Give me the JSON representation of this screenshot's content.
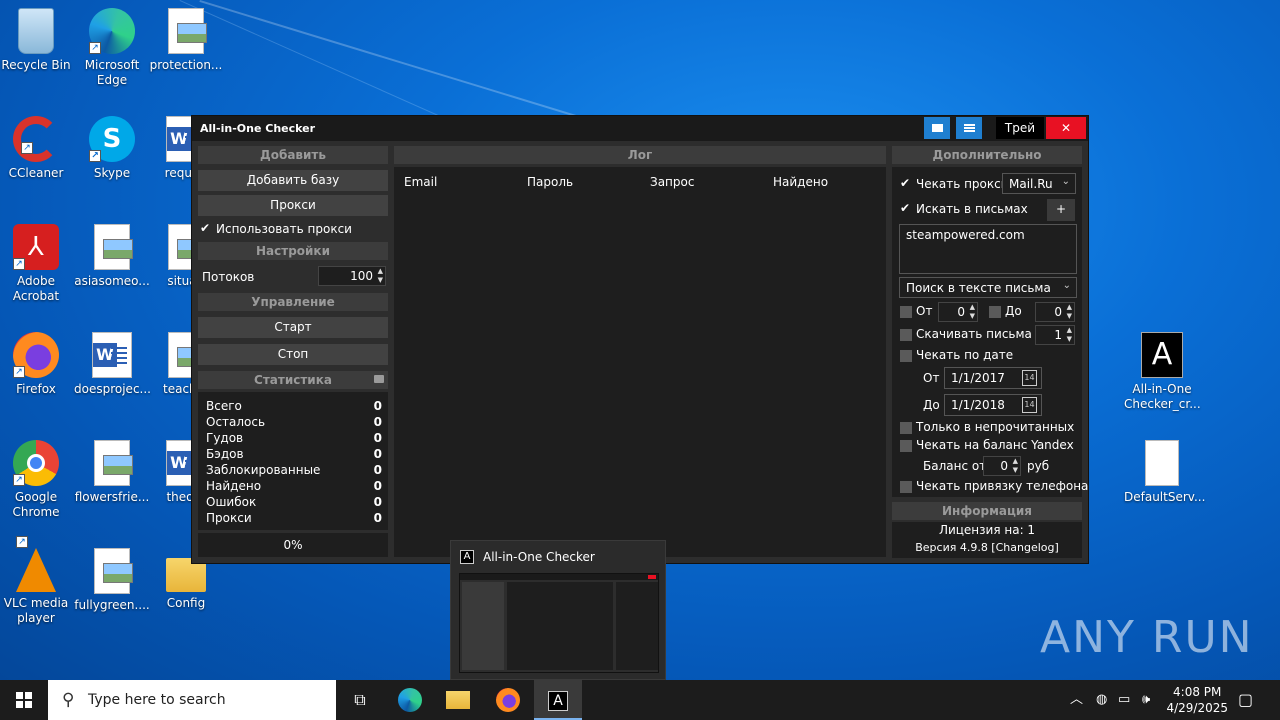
{
  "desktop": {
    "icons": [
      {
        "id": "recycle",
        "label": "Recycle Bin"
      },
      {
        "id": "edge",
        "label": "Microsoft Edge"
      },
      {
        "id": "protection",
        "label": "protection..."
      },
      {
        "id": "ccleaner",
        "label": "CCleaner"
      },
      {
        "id": "skype",
        "label": "Skype"
      },
      {
        "id": "require",
        "label": "require"
      },
      {
        "id": "acrobat",
        "label": "Adobe Acrobat"
      },
      {
        "id": "asiasomeo",
        "label": "asiasomeo..."
      },
      {
        "id": "situati",
        "label": "situati"
      },
      {
        "id": "firefox",
        "label": "Firefox"
      },
      {
        "id": "doesprojec",
        "label": "doesprojec..."
      },
      {
        "id": "teacher",
        "label": "teacher"
      },
      {
        "id": "chrome",
        "label": "Google Chrome"
      },
      {
        "id": "flowersfrie",
        "label": "flowersfrie..."
      },
      {
        "id": "theory",
        "label": "theory"
      },
      {
        "id": "vlc",
        "label": "VLC media player"
      },
      {
        "id": "fullygreen",
        "label": "fullygreen...."
      },
      {
        "id": "config",
        "label": "Config"
      },
      {
        "id": "aio",
        "label": "All-in-One Checker_cr..."
      },
      {
        "id": "defaultserv",
        "label": "DefaultServ..."
      }
    ],
    "watermark": "ANY RUN"
  },
  "window": {
    "title": "All-in-One Checker",
    "tray_label": "Трей",
    "close_glyph": "✕",
    "left": {
      "add_header": "Добавить",
      "add_base": "Добавить базу",
      "proxy": "Прокси",
      "use_proxy": "Использовать прокси",
      "settings_header": "Настройки",
      "threads_label": "Потоков",
      "threads_value": "100",
      "control_header": "Управление",
      "start": "Старт",
      "stop": "Стоп",
      "stats_header": "Статистика",
      "stats": [
        {
          "label": "Всего",
          "value": "0"
        },
        {
          "label": "Осталось",
          "value": "0"
        },
        {
          "label": "Гудов",
          "value": "0"
        },
        {
          "label": "Бэдов",
          "value": "0"
        },
        {
          "label": "Заблокированные",
          "value": "0"
        },
        {
          "label": "Найдено",
          "value": "0"
        },
        {
          "label": "Ошибок",
          "value": "0"
        },
        {
          "label": "Прокси",
          "value": "0"
        }
      ],
      "progress": "0%"
    },
    "log": {
      "header": "Лог",
      "columns": [
        "Email",
        "Пароль",
        "Запрос",
        "Найдено"
      ]
    },
    "right": {
      "header": "Дополнительно",
      "check_proxy": "Чекать прокси",
      "provider": "Mail.Ru",
      "search_in_letters": "Искать в письмах",
      "plus": "+",
      "search_text": "steampowered.com",
      "search_mode": "Поиск в тексте письма",
      "from_label": "От",
      "from_value": "0",
      "to_label": "До",
      "to_value": "0",
      "download_letters": "Скачивать письма",
      "download_value": "1",
      "check_by_date": "Чекать по дате",
      "date_from_label": "От",
      "date_from": "1/1/2017",
      "date_to_label": "До",
      "date_to": "1/1/2018",
      "unread_only": "Только в непрочитанных",
      "yandex_balance": "Чекать на баланс Yandex",
      "balance_from": "Баланс от",
      "balance_value": "0",
      "currency": "руб",
      "phone_binding": "Чекать привязку телефона",
      "info_header": "Информация",
      "license": "Лицензия на: 1",
      "version": "Версия 4.9.8 [Changelog]"
    }
  },
  "thumbnail": {
    "title": "All-in-One Checker"
  },
  "taskbar": {
    "search_placeholder": "Type here to search",
    "time": "4:08 PM",
    "date": "4/29/2025"
  }
}
